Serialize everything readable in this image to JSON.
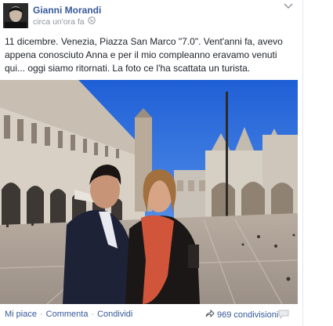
{
  "post": {
    "author": "Gianni Morandi",
    "timestamp": "circa un'ora fa",
    "text": "11 dicembre. Venezia, Piazza San Marco \"7.0\". Vent'anni fa, avevo appena conosciuto Anna e per il mio compleanno eravamo venuti qui... oggi siamo ritornati. La foto ce l'ha scattata un turista."
  },
  "actions": {
    "like": "Mi piace",
    "comment": "Commenta",
    "share": "Condividi",
    "separator": "·"
  },
  "shares": {
    "count_label": "969 condivisioni"
  },
  "icons": {
    "globe": "globe-icon",
    "chevron": "chevron-down-icon",
    "share": "share-arrow-icon",
    "comment": "comment-icon"
  },
  "colors": {
    "link": "#365899",
    "meta": "#90949c",
    "text": "#1d2129"
  }
}
